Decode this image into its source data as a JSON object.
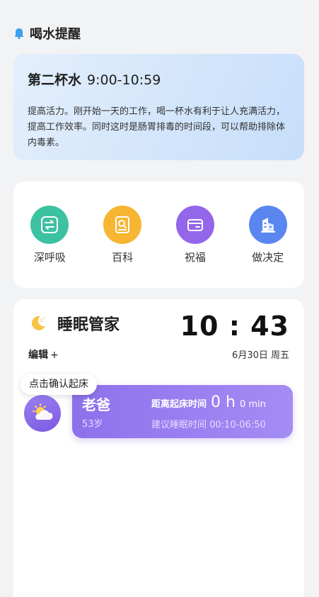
{
  "header": {
    "title": "喝水提醒",
    "icon": "bell-icon"
  },
  "tip": {
    "title": "第二杯水",
    "time": "9:00-10:59",
    "body": "提高活力。刚开始一天的工作，喝一杯水有利于让人充满活力，提高工作效率。同时这时是肠胃排毒的时间段，可以帮助排除体内毒素。"
  },
  "tools": [
    {
      "label": "深呼吸",
      "icon": "swap-icon",
      "color": "#3cc2a0"
    },
    {
      "label": "百科",
      "icon": "book-search-icon",
      "color": "#f7b531"
    },
    {
      "label": "祝福",
      "icon": "card-icon",
      "color": "#9466ea"
    },
    {
      "label": "做决定",
      "icon": "building-icon",
      "color": "#5a86f0"
    }
  ],
  "sleep": {
    "title": "睡眠管家",
    "clock": "10 : 43",
    "date": "6月30日 周五",
    "edit_label": "编辑",
    "edit_plus": "+",
    "bubble": "点击确认起床",
    "member": {
      "name": "老爸",
      "age": "53岁",
      "wake_label": "距离起床时间",
      "wake_hours": "0 h",
      "wake_minutes": "0 min",
      "suggest": "建议睡眠时间 00:10-06:50"
    }
  },
  "colors": {
    "accent_purple": "#8d71ec",
    "tip_bg": "#d6e7fb",
    "page_bg": "#f2f3f5"
  }
}
